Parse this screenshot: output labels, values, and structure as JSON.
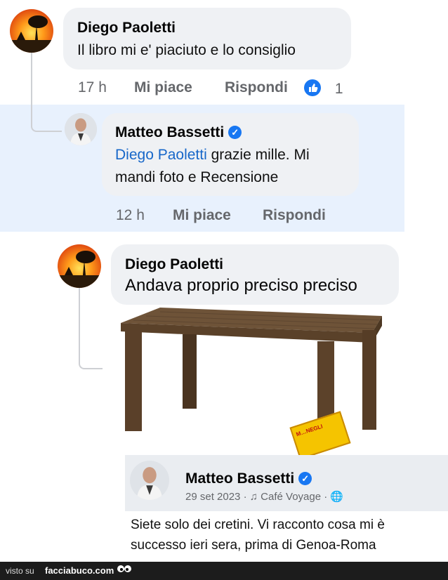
{
  "comments": [
    {
      "author": "Diego Paoletti",
      "text": "Il libro mi e' piaciuto e lo consiglio",
      "time": "17 h",
      "like_label": "Mi piace",
      "reply_label": "Rispondi",
      "reaction_count": "1"
    },
    {
      "author": "Matteo Bassetti",
      "mention": "Diego Paoletti",
      "text_line1": " grazie mille. Mi",
      "text_line2": "mandi foto e Recensione",
      "time": "12 h",
      "like_label": "Mi piace",
      "reply_label": "Rispondi"
    },
    {
      "author": "Diego Paoletti",
      "text": "Andava proprio preciso preciso"
    }
  ],
  "post": {
    "author": "Matteo Bassetti",
    "date": "29 set 2023",
    "music": "Café Voyage",
    "text_line1": "Siete solo dei cretini. Vi racconto cosa mi è",
    "text_line2": "successo ieri sera, prima di Genoa-Roma"
  },
  "book_sticker": {
    "text": "M…NEGLI"
  },
  "footer": {
    "prefix": "visto su",
    "site": "facciabuco.com"
  },
  "colors": {
    "highlight": "#e8f1fd",
    "bubble": "#eff1f4",
    "mention": "#1767c9",
    "verified": "#1877f2",
    "meta": "#65676b"
  }
}
